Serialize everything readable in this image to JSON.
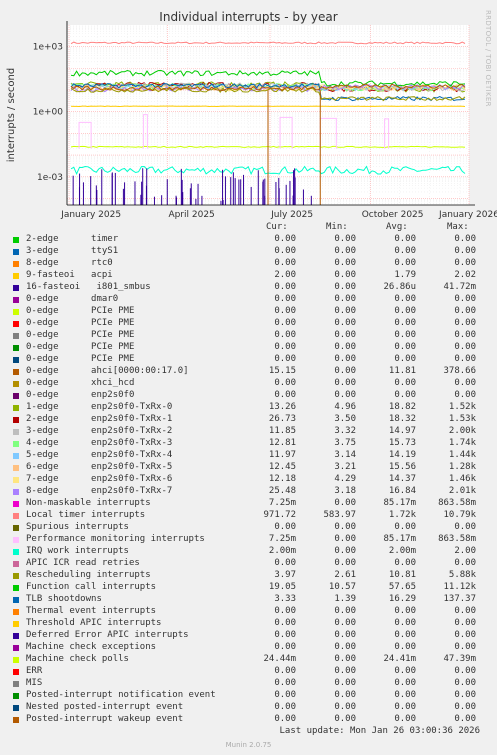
{
  "title": "Individual interrupts - by year",
  "credit": "RRDTOOL / TOBI OETIKER",
  "footer": {
    "last_update": "Last update: Mon Jan 26 03:00:36 2026",
    "munin": "Munin 2.0.75"
  },
  "legend_headers": {
    "cur": "Cur:",
    "min": "Min:",
    "avg": "Avg:",
    "max": "Max:"
  },
  "chart_data": {
    "type": "line",
    "title": "Individual interrupts - by year",
    "ylabel": "interrupts / second",
    "y_scale": "log",
    "ylim": [
      5e-05,
      10000
    ],
    "y_ticks": [
      {
        "v": 0.001,
        "label": "1e-03"
      },
      {
        "v": 1,
        "label": "1e+00"
      },
      {
        "v": 1000,
        "label": "1e+03"
      }
    ],
    "x_ticks": [
      "January 2025",
      "April 2025",
      "July 2025",
      "October 2025",
      "January 2026"
    ],
    "grid": true,
    "series": [
      {
        "name": "2-edge      timer",
        "color": "#00cc00",
        "cur": "0.00",
        "min": "0.00",
        "avg": "0.00",
        "max": "0.00"
      },
      {
        "name": "3-edge      ttyS1",
        "color": "#0066b3",
        "cur": "0.00",
        "min": "0.00",
        "avg": "0.00",
        "max": "0.00"
      },
      {
        "name": "8-edge      rtc0",
        "color": "#ff8000",
        "cur": "0.00",
        "min": "0.00",
        "avg": "0.00",
        "max": "0.00"
      },
      {
        "name": "9-fasteoi   acpi",
        "color": "#ffcc00",
        "cur": "2.00",
        "min": "0.00",
        "avg": "1.79",
        "max": "2.02"
      },
      {
        "name": "16-fasteoi   i801_smbus",
        "color": "#330099",
        "cur": "0.00",
        "min": "0.00",
        "avg": "26.86u",
        "max": "41.72m"
      },
      {
        "name": "0-edge      dmar0",
        "color": "#990099",
        "cur": "0.00",
        "min": "0.00",
        "avg": "0.00",
        "max": "0.00"
      },
      {
        "name": "0-edge      PCIe PME",
        "color": "#ccff00",
        "cur": "0.00",
        "min": "0.00",
        "avg": "0.00",
        "max": "0.00"
      },
      {
        "name": "0-edge      PCIe PME",
        "color": "#ff0000",
        "cur": "0.00",
        "min": "0.00",
        "avg": "0.00",
        "max": "0.00"
      },
      {
        "name": "0-edge      PCIe PME",
        "color": "#808080",
        "cur": "0.00",
        "min": "0.00",
        "avg": "0.00",
        "max": "0.00"
      },
      {
        "name": "0-edge      PCIe PME",
        "color": "#008f00",
        "cur": "0.00",
        "min": "0.00",
        "avg": "0.00",
        "max": "0.00"
      },
      {
        "name": "0-edge      PCIe PME",
        "color": "#00487d",
        "cur": "0.00",
        "min": "0.00",
        "avg": "0.00",
        "max": "0.00"
      },
      {
        "name": "0-edge      ahci[0000:00:17.0]",
        "color": "#b35a00",
        "cur": "15.15",
        "min": "0.00",
        "avg": "11.81",
        "max": "378.66"
      },
      {
        "name": "0-edge      xhci_hcd",
        "color": "#b38f00",
        "cur": "0.00",
        "min": "0.00",
        "avg": "0.00",
        "max": "0.00"
      },
      {
        "name": "0-edge      enp2s0f0",
        "color": "#6b006b",
        "cur": "0.00",
        "min": "0.00",
        "avg": "0.00",
        "max": "0.00"
      },
      {
        "name": "1-edge      enp2s0f0-TxRx-0",
        "color": "#8fb300",
        "cur": "13.26",
        "min": "4.96",
        "avg": "18.82",
        "max": "1.52k"
      },
      {
        "name": "2-edge      enp2s0f0-TxRx-1",
        "color": "#b30000",
        "cur": "26.73",
        "min": "3.50",
        "avg": "18.32",
        "max": "1.53k"
      },
      {
        "name": "3-edge      enp2s0f0-TxRx-2",
        "color": "#bebebe",
        "cur": "11.85",
        "min": "3.32",
        "avg": "14.97",
        "max": "2.00k"
      },
      {
        "name": "4-edge      enp2s0f0-TxRx-3",
        "color": "#80ff80",
        "cur": "12.81",
        "min": "3.75",
        "avg": "15.73",
        "max": "1.74k"
      },
      {
        "name": "5-edge      enp2s0f0-TxRx-4",
        "color": "#80c9ff",
        "cur": "11.97",
        "min": "3.14",
        "avg": "14.19",
        "max": "1.44k"
      },
      {
        "name": "6-edge      enp2s0f0-TxRx-5",
        "color": "#ffc080",
        "cur": "12.45",
        "min": "3.21",
        "avg": "15.56",
        "max": "1.28k"
      },
      {
        "name": "7-edge      enp2s0f0-TxRx-6",
        "color": "#ffe680",
        "cur": "12.18",
        "min": "4.29",
        "avg": "14.37",
        "max": "1.46k"
      },
      {
        "name": "8-edge      enp2s0f0-TxRx-7",
        "color": "#aa80ff",
        "cur": "25.48",
        "min": "3.18",
        "avg": "16.84",
        "max": "2.01k"
      },
      {
        "name": "Non-maskable interrupts",
        "color": "#ee00cc",
        "cur": "7.25m",
        "min": "0.00",
        "avg": "85.17m",
        "max": "863.58m"
      },
      {
        "name": "Local timer interrupts",
        "color": "#ff8080",
        "cur": "971.72",
        "min": "583.97",
        "avg": "1.72k",
        "max": "10.79k"
      },
      {
        "name": "Spurious interrupts",
        "color": "#666600",
        "cur": "0.00",
        "min": "0.00",
        "avg": "0.00",
        "max": "0.00"
      },
      {
        "name": "Performance monitoring interrupts",
        "color": "#ffbfff",
        "cur": "7.25m",
        "min": "0.00",
        "avg": "85.17m",
        "max": "863.58m"
      },
      {
        "name": "IRQ work interrupts",
        "color": "#00ffcc",
        "cur": "2.00m",
        "min": "0.00",
        "avg": "2.00m",
        "max": "2.00"
      },
      {
        "name": "APIC ICR read retries",
        "color": "#cc6699",
        "cur": "0.00",
        "min": "0.00",
        "avg": "0.00",
        "max": "0.00"
      },
      {
        "name": "Rescheduling interrupts",
        "color": "#999900",
        "cur": "3.97",
        "min": "2.61",
        "avg": "10.81",
        "max": "5.88k"
      },
      {
        "name": "Function call interrupts",
        "color": "#00cc00",
        "cur": "19.05",
        "min": "10.57",
        "avg": "57.65",
        "max": "11.12k"
      },
      {
        "name": "TLB shootdowns",
        "color": "#0066b3",
        "cur": "3.33",
        "min": "1.39",
        "avg": "16.29",
        "max": "137.37"
      },
      {
        "name": "Thermal event interrupts",
        "color": "#ff8000",
        "cur": "0.00",
        "min": "0.00",
        "avg": "0.00",
        "max": "0.00"
      },
      {
        "name": "Threshold APIC interrupts",
        "color": "#ffcc00",
        "cur": "0.00",
        "min": "0.00",
        "avg": "0.00",
        "max": "0.00"
      },
      {
        "name": "Deferred Error APIC interrupts",
        "color": "#330099",
        "cur": "0.00",
        "min": "0.00",
        "avg": "0.00",
        "max": "0.00"
      },
      {
        "name": "Machine check exceptions",
        "color": "#990099",
        "cur": "0.00",
        "min": "0.00",
        "avg": "0.00",
        "max": "0.00"
      },
      {
        "name": "Machine check polls",
        "color": "#ccff00",
        "cur": "24.44m",
        "min": "0.00",
        "avg": "24.41m",
        "max": "47.39m"
      },
      {
        "name": "ERR",
        "color": "#ff0000",
        "cur": "0.00",
        "min": "0.00",
        "avg": "0.00",
        "max": "0.00"
      },
      {
        "name": "MIS",
        "color": "#808080",
        "cur": "0.00",
        "min": "0.00",
        "avg": "0.00",
        "max": "0.00"
      },
      {
        "name": "Posted-interrupt notification event",
        "color": "#008f00",
        "cur": "0.00",
        "min": "0.00",
        "avg": "0.00",
        "max": "0.00"
      },
      {
        "name": "Nested posted-interrupt event",
        "color": "#00487d",
        "cur": "0.00",
        "min": "0.00",
        "avg": "0.00",
        "max": "0.00"
      },
      {
        "name": "Posted-interrupt wakeup event",
        "color": "#b35a00",
        "cur": "0.00",
        "min": "0.00",
        "avg": "0.00",
        "max": "0.00"
      }
    ]
  }
}
